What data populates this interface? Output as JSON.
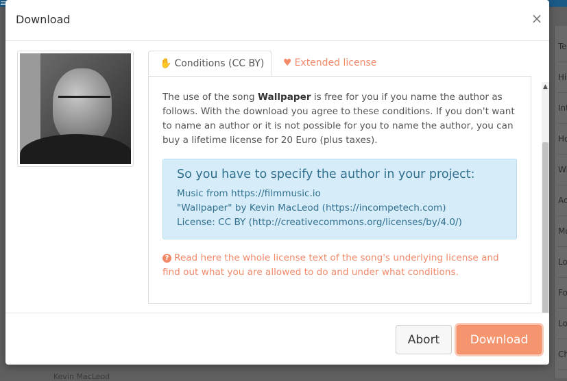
{
  "modal": {
    "title": "Download",
    "close_glyph": "×"
  },
  "tabs": [
    {
      "label": "Conditions (CC BY)",
      "icon": "hand-icon",
      "icon_glyph": "✋",
      "active": true
    },
    {
      "label": "Extended license",
      "icon": "heart-icon",
      "icon_glyph": "♥",
      "active": false
    }
  ],
  "content": {
    "paragraph_before": "The use of the song ",
    "song_title": "Wallpaper",
    "paragraph_after": " is free for you if you name the author as follows. With the download you agree to these conditions. If you don't want to name an author or it is not possible for you to name the author, you can buy a lifetime license for 20 Euro (plus taxes).",
    "attribution": {
      "heading": "So you have to specify the author in your project:",
      "lines": [
        "Music from https://filmmusic.io",
        "\"Wallpaper\" by Kevin MacLeod (https://incompetech.com)",
        "License: CC BY (http://creativecommons.org/licenses/by/4.0/)"
      ]
    },
    "help_link": "Read here the whole license text of the song's underlying license and find out what you are allowed to do and under what conditions."
  },
  "footer": {
    "abort_label": "Abort",
    "download_label": "Download"
  },
  "background": {
    "topbar_glyph": "≡",
    "right_list": [
      "Te",
      "His",
      "Int",
      "Ho",
      "Wi",
      "Ac",
      "Mo",
      "Lo",
      "Fo",
      "Lo",
      "Ch"
    ],
    "bottom_text": "Kevin MacLeod"
  },
  "colors": {
    "accent": "#f28a6a",
    "download_button": "#f5956f",
    "info_box_bg": "#d6ecf8",
    "info_box_text": "#31708f"
  }
}
